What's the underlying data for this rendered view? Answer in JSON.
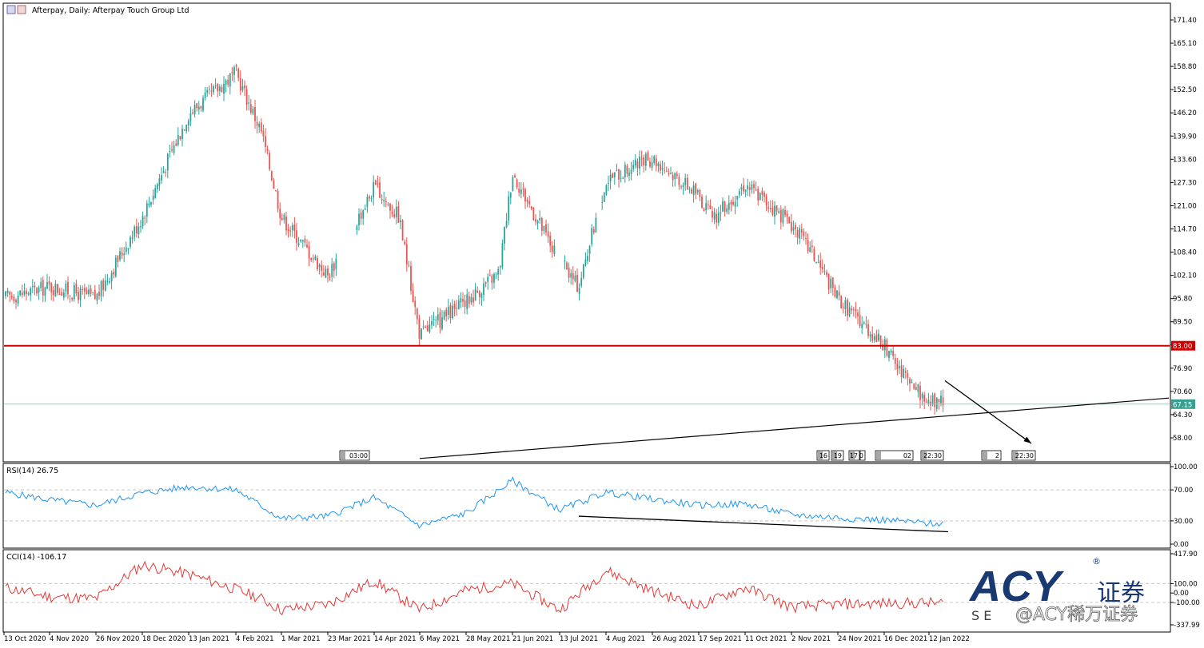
{
  "header": {
    "title": "Afterpay, Daily:  Afterpay Touch Group Ltd"
  },
  "colors": {
    "bull": "#26a69a",
    "bear": "#ef5350",
    "resistance_line": "#cc0000",
    "support_line": "#7fd7cb",
    "trend_line": "#000000",
    "rsi_line": "#2196f3",
    "cci_line": "#e53935",
    "grid": "#c8c8c8",
    "axis": "#000000",
    "watermark_blue": "#0d2f6b"
  },
  "chart_data": [
    {
      "type": "candlestick",
      "title": "Afterpay, Daily:  Afterpay Touch Group Ltd",
      "ylim": [
        52.4,
        175.6
      ],
      "y_ticks": [
        "171.40",
        "165.10",
        "158.80",
        "152.50",
        "146.20",
        "139.90",
        "133.60",
        "127.30",
        "121.00",
        "114.70",
        "108.40",
        "102.10",
        "95.80",
        "89.50",
        "83.20",
        "76.90",
        "70.60",
        "64.30",
        "58.00"
      ],
      "x_labels": [
        "13 Oct 2020",
        "4 Nov 2020",
        "26 Nov 2020",
        "18 Dec 2020",
        "13 Jan 2021",
        "4 Feb 2021",
        "1 Mar 2021",
        "23 Mar 2021",
        "14 Apr 2021",
        "6 May 2021",
        "28 May 2021",
        "21 Jun 2021",
        "13 Jul 2021",
        "4 Aug 2021",
        "26 Aug 2021",
        "17 Sep 2021",
        "11 Oct 2021",
        "2 Nov 2021",
        "24 Nov 2021",
        "16 Dec 2021",
        "12 Jan 2022"
      ],
      "close_anchors": [
        {
          "x": "13 Oct 2020",
          "y": 96
        },
        {
          "x": "4 Nov 2020",
          "y": 99
        },
        {
          "x": "26 Nov 2020",
          "y": 96
        },
        {
          "x": "18 Dec 2020",
          "y": 118
        },
        {
          "x": "13 Jan 2021",
          "y": 146
        },
        {
          "x": "4 Feb 2021",
          "y": 157
        },
        {
          "x": "18 Feb 2021",
          "y": 141
        },
        {
          "x": "1 Mar 2021",
          "y": 118
        },
        {
          "x": "23 Mar 2021",
          "y": 102
        },
        {
          "x": "14 Apr 2021",
          "y": 126
        },
        {
          "x": "26 Apr 2021",
          "y": 118
        },
        {
          "x": "6 May 2021",
          "y": 86
        },
        {
          "x": "28 May 2021",
          "y": 95
        },
        {
          "x": "14 Jun 2021",
          "y": 103
        },
        {
          "x": "21 Jun 2021",
          "y": 130
        },
        {
          "x": "1 Jul 2021",
          "y": 119
        },
        {
          "x": "13 Jul 2021",
          "y": 106
        },
        {
          "x": "22 Jul 2021",
          "y": 99
        },
        {
          "x": "4 Aug 2021",
          "y": 128
        },
        {
          "x": "26 Aug 2021",
          "y": 134
        },
        {
          "x": "17 Sep 2021",
          "y": 124
        },
        {
          "x": "24 Sep 2021",
          "y": 117
        },
        {
          "x": "11 Oct 2021",
          "y": 127
        },
        {
          "x": "2 Nov 2021",
          "y": 116
        },
        {
          "x": "12 Nov 2021",
          "y": 108
        },
        {
          "x": "24 Nov 2021",
          "y": 96
        },
        {
          "x": "16 Dec 2021",
          "y": 83
        },
        {
          "x": "27 Dec 2021",
          "y": 75
        },
        {
          "x": "12 Jan 2022",
          "y": 67.5
        }
      ],
      "horizontal_lines": [
        {
          "value": 83.0,
          "label": "83.00",
          "style": "resistance"
        },
        {
          "value": 67.15,
          "label": "67.15",
          "style": "support"
        }
      ],
      "trend_lines": [
        {
          "from": {
            "x": "6 May 2021",
            "y": 52.4
          },
          "to": {
            "x": "end",
            "y": 68.8
          }
        },
        {
          "from": {
            "x": "12 Jan 2022",
            "y": 73.5
          },
          "to": {
            "x": "arrow",
            "y": 56.5
          },
          "arrow": true
        }
      ],
      "session_markers": [
        "03:00",
        "16",
        "19",
        "17",
        "0",
        "02",
        "22:30",
        "2",
        "22:30"
      ]
    },
    {
      "type": "line",
      "title": "RSI(14) 26.75",
      "ylim": [
        0,
        100
      ],
      "y_ticks": [
        "100.00",
        "70.00",
        "30.00",
        "0.00"
      ],
      "levels": [
        70,
        30
      ],
      "last_value": 26.75,
      "anchors": [
        {
          "x": "13 Oct 2020",
          "y": 67
        },
        {
          "x": "4 Nov 2020",
          "y": 57
        },
        {
          "x": "26 Nov 2020",
          "y": 50
        },
        {
          "x": "18 Dec 2020",
          "y": 66
        },
        {
          "x": "13 Jan 2021",
          "y": 74
        },
        {
          "x": "4 Feb 2021",
          "y": 70
        },
        {
          "x": "1 Mar 2021",
          "y": 33
        },
        {
          "x": "23 Mar 2021",
          "y": 36
        },
        {
          "x": "14 Apr 2021",
          "y": 60
        },
        {
          "x": "6 May 2021",
          "y": 24
        },
        {
          "x": "28 May 2021",
          "y": 40
        },
        {
          "x": "21 Jun 2021",
          "y": 82
        },
        {
          "x": "13 Jul 2021",
          "y": 44
        },
        {
          "x": "4 Aug 2021",
          "y": 67
        },
        {
          "x": "26 Aug 2021",
          "y": 58
        },
        {
          "x": "17 Sep 2021",
          "y": 50
        },
        {
          "x": "11 Oct 2021",
          "y": 52
        },
        {
          "x": "2 Nov 2021",
          "y": 38
        },
        {
          "x": "24 Nov 2021",
          "y": 34
        },
        {
          "x": "16 Dec 2021",
          "y": 31
        },
        {
          "x": "12 Jan 2022",
          "y": 26.75
        }
      ],
      "trend_line": {
        "from": {
          "x": "13 Jul 2021",
          "y": 36
        },
        "to": {
          "x": "12 Jan 2022",
          "y": 16
        }
      }
    },
    {
      "type": "line",
      "title": "CCI(14) -106.17",
      "ylim": [
        -337.99,
        417.9
      ],
      "y_ticks": [
        "417.90",
        "100.00",
        "0.00",
        "-100.00",
        "-337.99"
      ],
      "levels": [
        100,
        -100
      ],
      "last_value": -106.17,
      "anchors": [
        {
          "x": "13 Oct 2020",
          "y": 60
        },
        {
          "x": "4 Nov 2020",
          "y": -40
        },
        {
          "x": "26 Nov 2020",
          "y": -60
        },
        {
          "x": "18 Dec 2020",
          "y": 300
        },
        {
          "x": "13 Jan 2021",
          "y": 200
        },
        {
          "x": "4 Feb 2021",
          "y": 40
        },
        {
          "x": "18 Feb 2021",
          "y": -60
        },
        {
          "x": "1 Mar 2021",
          "y": -180
        },
        {
          "x": "23 Mar 2021",
          "y": -120
        },
        {
          "x": "14 Apr 2021",
          "y": 130
        },
        {
          "x": "6 May 2021",
          "y": -180
        },
        {
          "x": "28 May 2021",
          "y": 30
        },
        {
          "x": "21 Jun 2021",
          "y": 100
        },
        {
          "x": "13 Jul 2021",
          "y": -180
        },
        {
          "x": "4 Aug 2021",
          "y": 240
        },
        {
          "x": "26 Aug 2021",
          "y": 20
        },
        {
          "x": "17 Sep 2021",
          "y": -140
        },
        {
          "x": "11 Oct 2021",
          "y": 60
        },
        {
          "x": "2 Nov 2021",
          "y": -150
        },
        {
          "x": "24 Nov 2021",
          "y": -120
        },
        {
          "x": "16 Dec 2021",
          "y": -110
        },
        {
          "x": "12 Jan 2022",
          "y": -106.17
        }
      ]
    }
  ],
  "watermark": {
    "brand": "ACY",
    "registered": "®",
    "cn": "证券",
    "sub": "S E",
    "handle": "@ACY稀万证券"
  }
}
